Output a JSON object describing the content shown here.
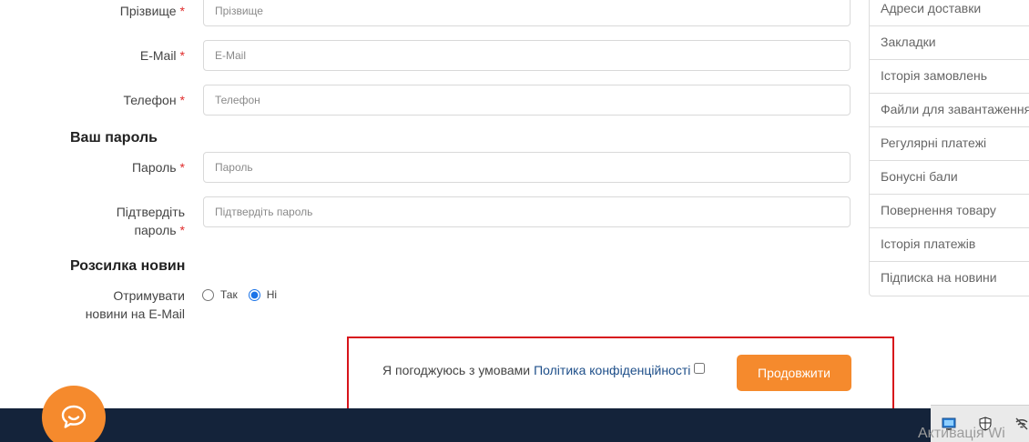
{
  "form": {
    "lastname": {
      "label": "Прізвище",
      "placeholder": "Прізвище"
    },
    "email": {
      "label": "E-Mail",
      "placeholder": "E-Mail"
    },
    "phone": {
      "label": "Телефон",
      "placeholder": "Телефон"
    },
    "password_section_title": "Ваш пароль",
    "password": {
      "label": "Пароль",
      "placeholder": "Пароль"
    },
    "confirm": {
      "label_line1": "Підтвердіть",
      "label_line2": "пароль",
      "placeholder": "Підтвердіть пароль"
    },
    "required_mark": "*",
    "newsletter_section_title": "Розсилка новин",
    "newsletter": {
      "label_line1": "Отримувати",
      "label_line2": "новини на E-Mail",
      "option_yes": "Так",
      "option_no": "Ні",
      "selected": "no"
    }
  },
  "sidebar": {
    "items": [
      {
        "label": "Адреси доставки"
      },
      {
        "label": "Закладки"
      },
      {
        "label": "Історія замовлень"
      },
      {
        "label": "Файли для завантаження"
      },
      {
        "label": "Регулярні платежі"
      },
      {
        "label": "Бонусні бали"
      },
      {
        "label": "Повернення товару"
      },
      {
        "label": "Історія платежів"
      },
      {
        "label": "Підписка на новини"
      }
    ]
  },
  "agreement": {
    "text": "Я погоджуюсь з умовами",
    "link": "Політика конфіденційності",
    "checked": false,
    "continue_label": "Продовжити"
  },
  "colors": {
    "accent": "#f58a2d",
    "footer": "#14233a",
    "highlight_border": "#d7141b",
    "link": "#1d4e89"
  },
  "watermark": {
    "text": "Активація Wi"
  },
  "icons": {
    "chat": "chat-bubble-icon",
    "tray": [
      "monitor-icon",
      "shield-icon",
      "network-off-icon"
    ]
  }
}
